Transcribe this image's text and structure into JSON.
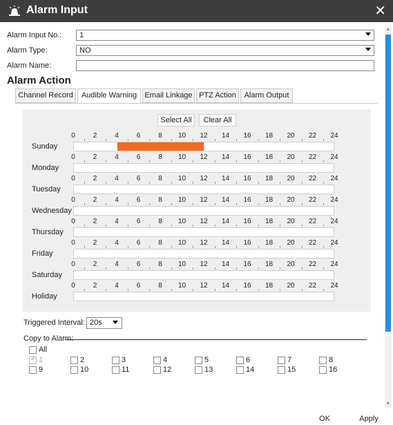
{
  "window": {
    "title": "Alarm Input"
  },
  "fields": {
    "alarm_input_no": {
      "label": "Alarm Input No.:",
      "value": "1"
    },
    "alarm_type": {
      "label": "Alarm Type:",
      "value": "NO"
    },
    "alarm_name": {
      "label": "Alarm Name:",
      "value": ""
    }
  },
  "section_title": "Alarm Action",
  "tabs": [
    "Channel Record",
    "Audible Warning",
    "Email Linkage",
    "PTZ Action",
    "Alarm Output"
  ],
  "active_tab": "Audible Warning",
  "schedule": {
    "select_all": "Select All",
    "clear_all": "Clear All",
    "hour_labels": [
      "0",
      "2",
      "4",
      "6",
      "8",
      "10",
      "12",
      "14",
      "16",
      "18",
      "20",
      "22",
      "24"
    ],
    "days": [
      {
        "name": "Sunday",
        "ranges": [
          [
            4,
            12
          ]
        ]
      },
      {
        "name": "Monday",
        "ranges": []
      },
      {
        "name": "Tuesday",
        "ranges": []
      },
      {
        "name": "Wednesday",
        "ranges": []
      },
      {
        "name": "Thursday",
        "ranges": []
      },
      {
        "name": "Friday",
        "ranges": []
      },
      {
        "name": "Saturday",
        "ranges": []
      },
      {
        "name": "Holiday",
        "ranges": []
      }
    ],
    "fill_color": "#f36a1f"
  },
  "triggered_interval": {
    "label": "Triggered Interval:",
    "value": "20s"
  },
  "copy_to_alarm": {
    "label": "Copy to Alarm:",
    "all_label": "All",
    "items": [
      {
        "label": "1",
        "checked": true,
        "disabled": true
      },
      {
        "label": "2",
        "checked": false,
        "disabled": false
      },
      {
        "label": "3",
        "checked": false,
        "disabled": false
      },
      {
        "label": "4",
        "checked": false,
        "disabled": false
      },
      {
        "label": "5",
        "checked": false,
        "disabled": false
      },
      {
        "label": "6",
        "checked": false,
        "disabled": false
      },
      {
        "label": "7",
        "checked": false,
        "disabled": false
      },
      {
        "label": "8",
        "checked": false,
        "disabled": false
      },
      {
        "label": "9",
        "checked": false,
        "disabled": false
      },
      {
        "label": "10",
        "checked": false,
        "disabled": false
      },
      {
        "label": "11",
        "checked": false,
        "disabled": false
      },
      {
        "label": "12",
        "checked": false,
        "disabled": false
      },
      {
        "label": "13",
        "checked": false,
        "disabled": false
      },
      {
        "label": "14",
        "checked": false,
        "disabled": false
      },
      {
        "label": "15",
        "checked": false,
        "disabled": false
      },
      {
        "label": "16",
        "checked": false,
        "disabled": false
      }
    ]
  },
  "buttons": {
    "ok": "OK",
    "apply": "Apply"
  },
  "icons": {
    "title_icon": "alarm-siren-icon",
    "close_icon": "close-icon"
  },
  "colors": {
    "titlebar": "#3d3d3d",
    "scrollbar": "#2a8fe0",
    "schedule_fill": "#f36a1f"
  }
}
